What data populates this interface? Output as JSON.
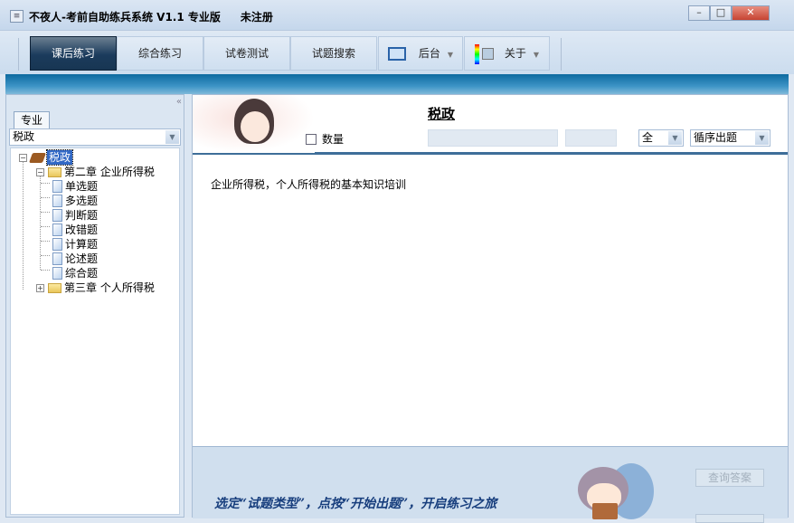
{
  "window": {
    "title": "不夜人-考前自助练兵系统 V1.1  专业版",
    "registration": "未注册"
  },
  "toolbar": {
    "items": [
      {
        "label": "课后练习"
      },
      {
        "label": "综合练习"
      },
      {
        "label": "试卷测试"
      },
      {
        "label": "试题搜索"
      },
      {
        "label": "后台"
      },
      {
        "label": "关于"
      }
    ]
  },
  "sidebar": {
    "tab": "专业",
    "subject_select": "税政",
    "tree": {
      "root": "税政",
      "chapters": [
        {
          "label": "第二章  企业所得税",
          "children": [
            "单选题",
            "多选题",
            "判断题",
            "改错题",
            "计算题",
            "论述题",
            "综合题"
          ]
        },
        {
          "label": "第三章  个人所得税"
        }
      ]
    }
  },
  "main": {
    "title": "税政",
    "quantity_label": "数量",
    "scope_select": "全",
    "order_select": "循序出题",
    "description": "企业所得税，个人所得税的基本知识培训",
    "slogan": "选定“试题类型”，点按“开始出题”，开启练习之旅",
    "query_answer_button": "查询答案"
  }
}
